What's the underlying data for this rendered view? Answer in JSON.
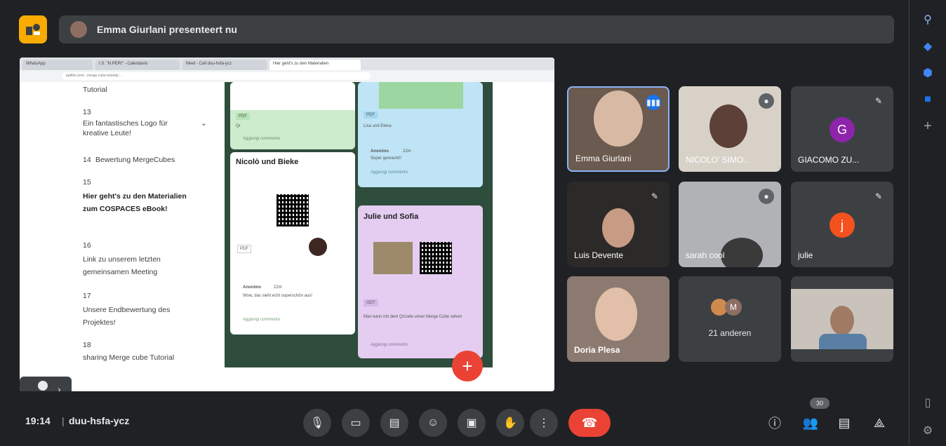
{
  "banner": {
    "presenter_text": "Emma Giurlani presenteert nu"
  },
  "browser": {
    "tabs": [
      "WhatsApp",
      "I.S. \"N.PERI\" - Calendario",
      "Meet - Call duu-hsfa-ycz",
      "Hier geht's zu den Materialien"
    ],
    "url": "padlet.com/...merge-cube-tutorial/..."
  },
  "toc": {
    "items": [
      {
        "num": "",
        "text": "Tutorial",
        "bold": false
      },
      {
        "num": "13",
        "text": "Ein fantastisches Logo für kreative Leute!",
        "bold": false
      },
      {
        "num": "14",
        "text": "Bewertung MergeCubes",
        "bold": false
      },
      {
        "num": "15",
        "text": "Hier geht's zu den Materialien zum COSPACES eBook!",
        "bold": true
      },
      {
        "num": "16",
        "text": "Link zu unserem letzten gemeinsamen Meeting",
        "bold": false
      },
      {
        "num": "17",
        "text": "Unsere Endbewertung des Projektes!",
        "bold": false
      },
      {
        "num": "18",
        "text": "sharing Merge cube Tutorial",
        "bold": false
      }
    ]
  },
  "board": {
    "card1": {
      "badge": "PDF",
      "sub": "Qr",
      "comment": "Aggiungi commento"
    },
    "card2": {
      "badge": "PDF",
      "sub": "Lisa und Elena",
      "author": "Anonimo",
      "time": "22m",
      "text": "Super gemacht!!",
      "comment": "Aggiungi commento"
    },
    "card3": {
      "title": "Nicolò und Bieke",
      "badge": "PDF",
      "author": "Anonimo",
      "time": "22m",
      "text": "Wow, das sieht echt superschön aus!",
      "comment": "Aggiungi commento"
    },
    "card4": {
      "title": "Julie und Sofia",
      "badge": "ODT",
      "text": "Man kann mit dem Qrcode unser Merge Cube sehen",
      "comment": "Aggiungi commento"
    },
    "fab": "+"
  },
  "participants": [
    {
      "name": "Emma Giurlani",
      "avatar": "",
      "color": "#8d6e63"
    },
    {
      "name": "NICOLO' SIMO...",
      "avatar": "",
      "color": "#6d5c4e"
    },
    {
      "name": "GIACOMO ZU...",
      "avatar": "G",
      "color": "#8e24aa"
    },
    {
      "name": "Luis Devente",
      "avatar": "",
      "color": "#4e4640"
    },
    {
      "name": "sarah cool",
      "avatar": "",
      "color": "#8a8c90"
    },
    {
      "name": "julie",
      "avatar": "j",
      "color": "#f4511e"
    },
    {
      "name": "Doria Plesa",
      "avatar": "",
      "color": "#b58f7a"
    },
    {
      "name": "21 anderen",
      "avatar": "M",
      "color": "#8d6e63"
    },
    {
      "name": "",
      "avatar": "",
      "color": "#c9c3bb"
    }
  ],
  "bottom": {
    "time": "19:14",
    "separator": "|",
    "meeting_code": "duu-hsfa-ycz",
    "participant_count": "30"
  }
}
